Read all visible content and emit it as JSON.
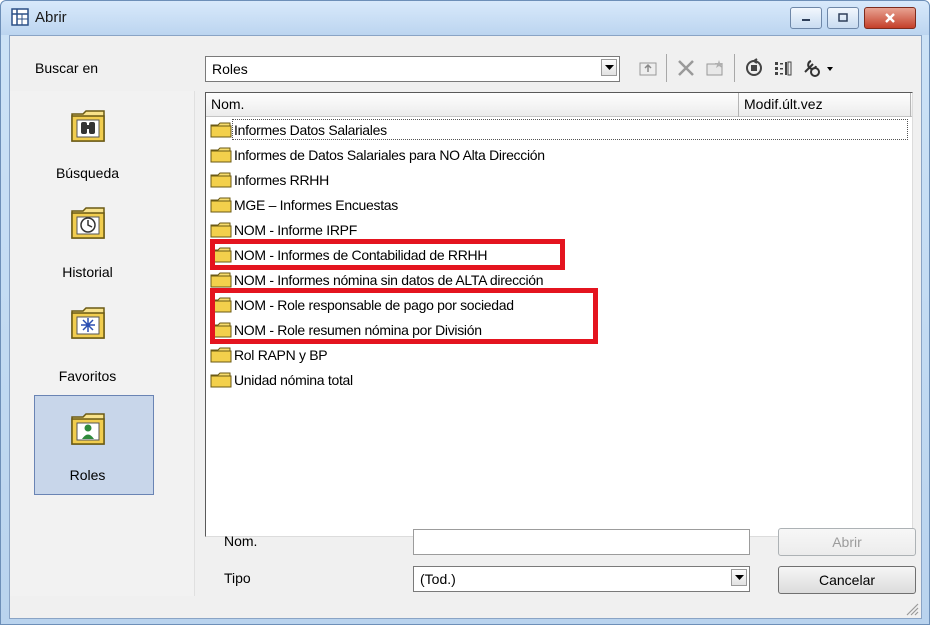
{
  "window": {
    "title": "Abrir"
  },
  "toolbar": {
    "look_in_label": "Buscar en",
    "look_in_value": "Roles",
    "icons": [
      "up-folder-icon",
      "delete-icon",
      "new-folder-icon",
      "refresh-icon",
      "view-menu-icon",
      "tools-icon"
    ]
  },
  "places": [
    {
      "label": "Búsqueda",
      "icon": "binoculars-folder-icon"
    },
    {
      "label": "Historial",
      "icon": "clock-folder-icon"
    },
    {
      "label": "Favoritos",
      "icon": "star-folder-icon"
    },
    {
      "label": "Roles",
      "icon": "user-folder-icon",
      "selected": true
    }
  ],
  "columns": {
    "name": "Nom.",
    "modified": "Modif.últ.vez"
  },
  "files": [
    "Informes Datos Salariales",
    "Informes de Datos Salariales para NO Alta Dirección",
    "Informes RRHH",
    "MGE – Informes Encuestas",
    "NOM - Informe IRPF",
    "NOM - Informes de Contabilidad de RRHH",
    "NOM - Informes nómina sin datos de ALTA dirección",
    "NOM - Role responsable de pago por sociedad",
    "NOM - Role resumen nómina por División",
    "Rol RAPN y BP",
    "Unidad nómina total"
  ],
  "form": {
    "name_label": "Nom.",
    "name_value": "",
    "type_label": "Tipo",
    "type_value": "(Tod.)",
    "open_button": "Abrir",
    "cancel_button": "Cancelar"
  },
  "colors": {
    "highlight": "#e4141f",
    "folder": "#f2d25a",
    "selected_place": "#c8d6ea"
  }
}
